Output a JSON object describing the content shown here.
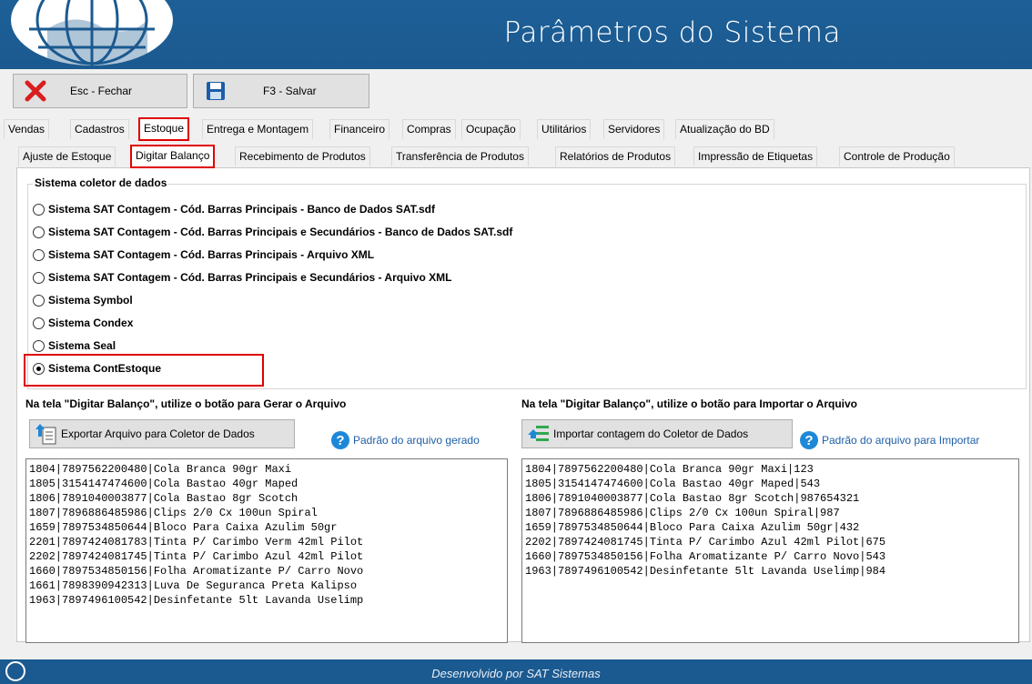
{
  "header": {
    "title": "Parâmetros do Sistema"
  },
  "toolbar": {
    "close_label": "Esc - Fechar",
    "save_label": "F3 - Salvar"
  },
  "main_tabs": [
    "Vendas",
    "Cadastros",
    "Estoque",
    "Entrega e Montagem",
    "Financeiro",
    "Compras",
    "Ocupação",
    "Utilitários",
    "Servidores",
    "Atualização do BD"
  ],
  "sub_tabs": [
    "Ajuste de Estoque",
    "Digitar Balanço",
    "Recebimento de Produtos",
    "Transferência de Produtos",
    "Relatórios de Produtos",
    "Impressão de Etiquetas",
    "Controle de Produção"
  ],
  "collector": {
    "title": "Sistema coletor de dados",
    "options": [
      "Sistema SAT Contagem - Cód. Barras Principais - Banco de Dados SAT.sdf",
      "Sistema SAT Contagem - Cód. Barras Principais e Secundários - Banco de Dados SAT.sdf",
      "Sistema SAT Contagem - Cód. Barras Principais - Arquivo XML",
      "Sistema SAT Contagem - Cód. Barras Principais e Secundários - Arquivo XML",
      "Sistema Symbol",
      "Sistema Condex",
      "Sistema Seal",
      "Sistema ContEstoque"
    ],
    "selected_index": 7
  },
  "export": {
    "label": "Na tela \"Digitar Balanço\", utilize o botão para Gerar o Arquivo",
    "button": "Exportar Arquivo para Coletor de Dados",
    "help": "Padrão do arquivo gerado",
    "content": "1804|7897562200480|Cola Branca 90gr Maxi\n1805|3154147474600|Cola Bastao 40gr Maped\n1806|7891040003877|Cola Bastao 8gr Scotch\n1807|7896886485986|Clips 2/0 Cx 100un Spiral\n1659|7897534850644|Bloco Para Caixa Azulim 50gr\n2201|7897424081783|Tinta P/ Carimbo Verm 42ml Pilot\n2202|7897424081745|Tinta P/ Carimbo Azul 42ml Pilot\n1660|7897534850156|Folha Aromatizante P/ Carro Novo\n1661|7898390942313|Luva De Seguranca Preta Kalipso\n1963|7897496100542|Desinfetante 5lt Lavanda Uselimp"
  },
  "import": {
    "label": "Na tela \"Digitar Balanço\", utilize o botão para Importar o Arquivo",
    "button": "Importar contagem do Coletor de Dados",
    "help": "Padrão do arquivo para Importar",
    "content": "1804|7897562200480|Cola Branca 90gr Maxi|123\n1805|3154147474600|Cola Bastao 40gr Maped|543\n1806|7891040003877|Cola Bastao 8gr Scotch|987654321\n1807|7896886485986|Clips 2/0 Cx 100un Spiral|987\n1659|7897534850644|Bloco Para Caixa Azulim 50gr|432\n2202|7897424081745|Tinta P/ Carimbo Azul 42ml Pilot|675\n1660|7897534850156|Folha Aromatizante P/ Carro Novo|543\n1963|7897496100542|Desinfetante 5lt Lavanda Uselimp|984"
  },
  "footer": {
    "text": "Desenvolvido por SAT Sistemas"
  }
}
